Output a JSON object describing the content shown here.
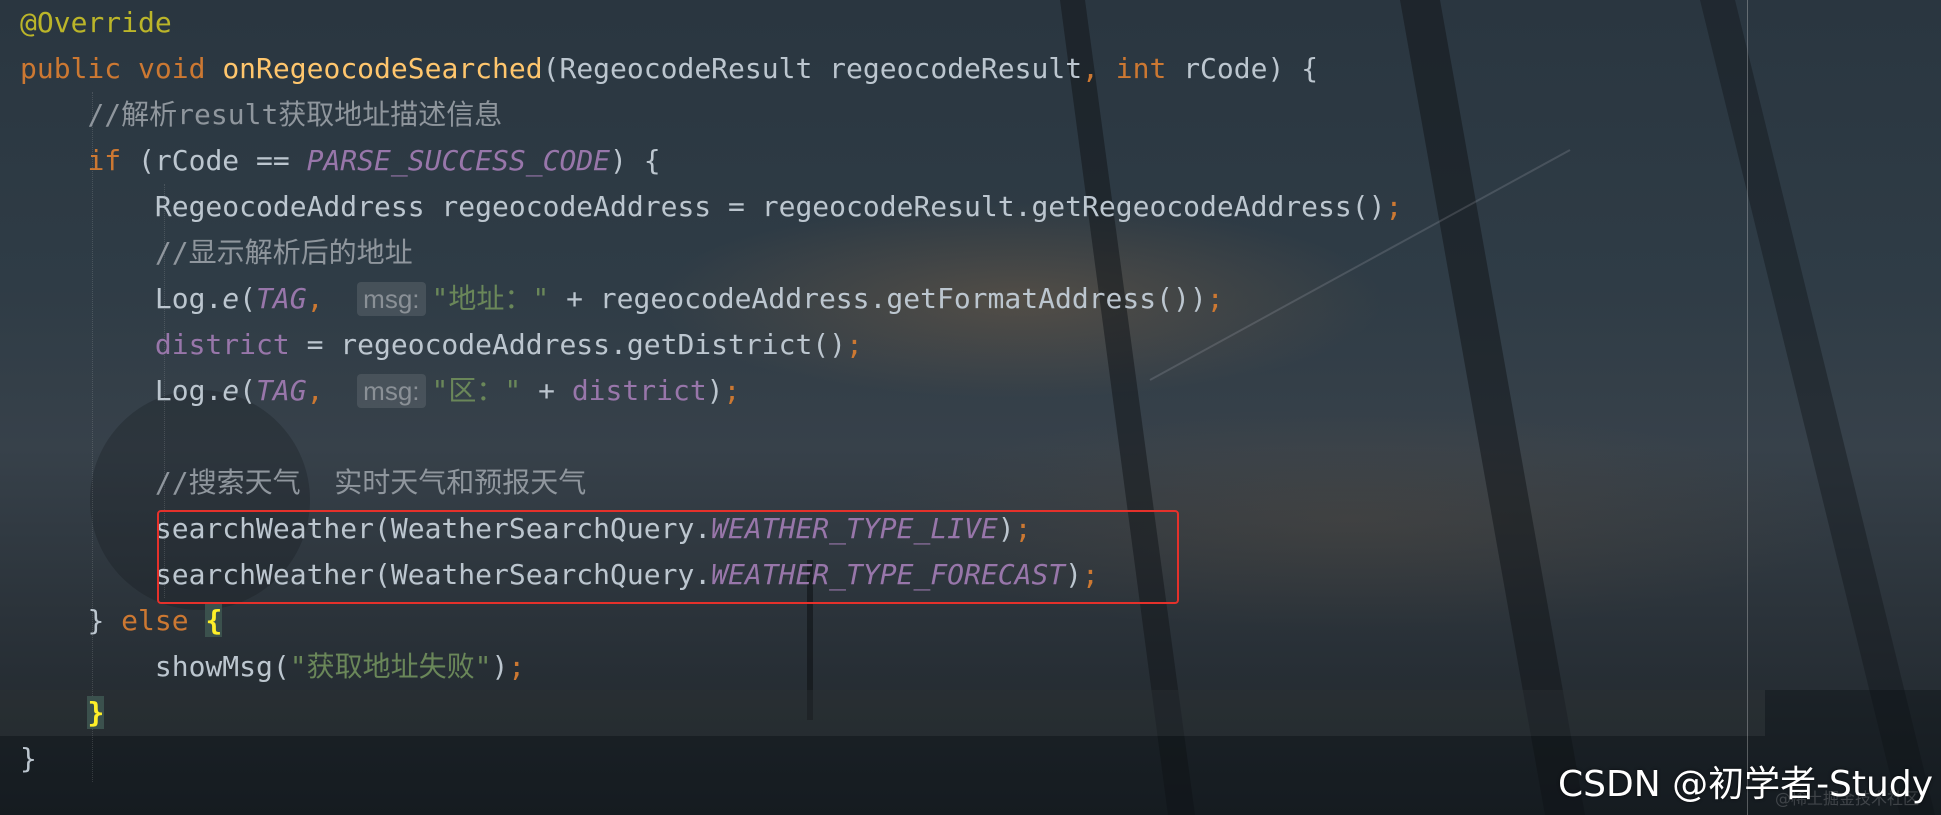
{
  "colors": {
    "keyword": "#cc7832",
    "annotation": "#bbb529",
    "method_declaration": "#ffc66d",
    "comment": "#8f969d",
    "constant": "#9876aa",
    "string": "#6a8759",
    "default_text": "#bcc6cf",
    "highlight_box": "#e5312b",
    "brace_match": "#ffef28"
  },
  "code": {
    "l1": {
      "annotation": "@Override"
    },
    "l2": {
      "kw_public": "public",
      "kw_void": "void",
      "method": "onRegeocodeSearched",
      "params_a": "(RegeocodeResult regeocodeResult",
      "comma": ",",
      "kw_int": "int",
      "params_b": "rCode) {"
    },
    "l3": {
      "comment": "//解析result获取地址描述信息"
    },
    "l4": {
      "kw_if": "if",
      "open": "(rCode == ",
      "constant": "PARSE_SUCCESS_CODE",
      "close": ") {"
    },
    "l5": {
      "text": "RegeocodeAddress regeocodeAddress = regeocodeResult.getRegeocodeAddress()",
      "semi": ";"
    },
    "l6": {
      "comment": "//显示解析后的地址"
    },
    "l7": {
      "log": "Log.",
      "method": "e",
      "open": "(",
      "tag": "TAG",
      "comma": ",",
      "hint": "msg:",
      "string": "\"地址：\"",
      "rest": " + regeocodeAddress.getFormatAddress())",
      "semi": ";"
    },
    "l8": {
      "field": "district",
      "rest": " = regeocodeAddress.getDistrict()",
      "semi": ";"
    },
    "l9": {
      "log": "Log.",
      "method": "e",
      "open": "(",
      "tag": "TAG",
      "comma": ",",
      "hint": "msg:",
      "string": "\"区：\"",
      "plus": " + ",
      "field": "district",
      "close": ")",
      "semi": ";"
    },
    "l11": {
      "comment": "//搜索天气  实时天气和预报天气"
    },
    "l12": {
      "call": "searchWeather(WeatherSearchQuery.",
      "constant": "WEATHER_TYPE_LIVE",
      "close": ")",
      "semi": ";"
    },
    "l13": {
      "call": "searchWeather(WeatherSearchQuery.",
      "constant": "WEATHER_TYPE_FORECAST",
      "close": ")",
      "semi": ";"
    },
    "l14": {
      "close": "} ",
      "kw_else": "else",
      "brace": "{"
    },
    "l15": {
      "call": "showMsg(",
      "string": "\"获取地址失败\"",
      "close": ")",
      "semi": ";"
    },
    "l16": {
      "brace": "}"
    },
    "l17": {
      "brace": "}"
    }
  },
  "watermark": {
    "text": "CSDN @初学者-Study",
    "faint": "@稀土掘金技术社区"
  }
}
